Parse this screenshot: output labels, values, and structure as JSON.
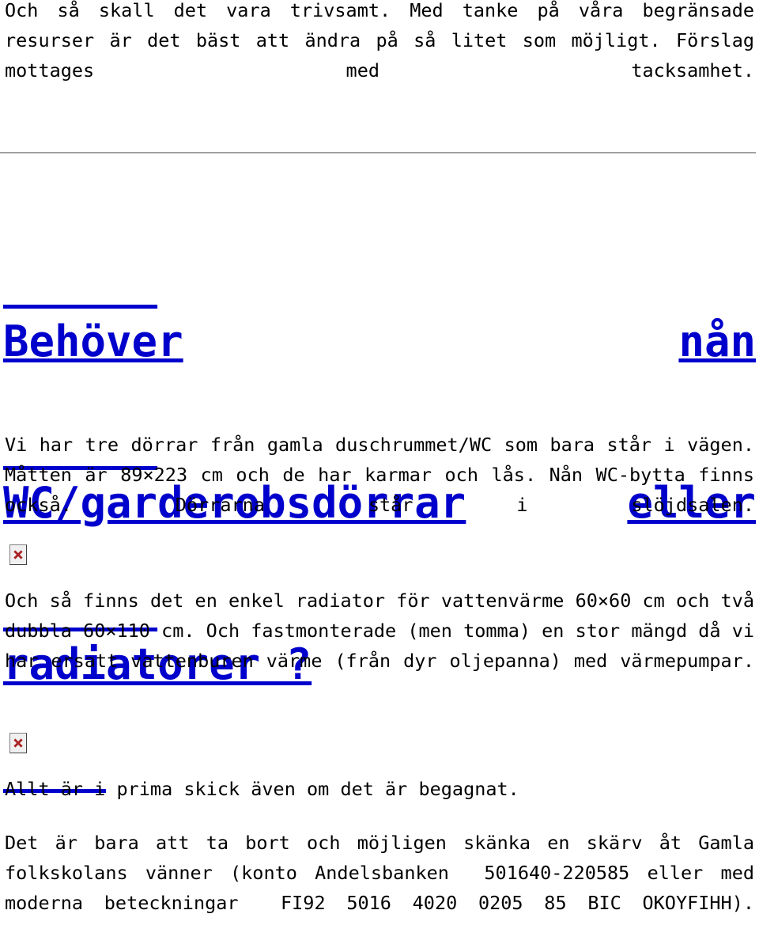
{
  "document": {
    "language": "sv",
    "background_color": "#ffffff",
    "body_text_color": "#000000",
    "link_color": "#0000cc",
    "rule_color": "#b0b0b0"
  },
  "intro": {
    "text": "Och så skall det vara trivsamt. Med tanke på våra begränsade resurser är det bäst att ändra på så litet som möjligt. Förslag mottages med tacksamhet."
  },
  "divider": {
    "name": "horizontal-rule"
  },
  "heading": {
    "full_text": "Behöver nån WC/garderobsdörrar eller radiatorer ?",
    "line1_left": "Behöver",
    "line1_right": "nån",
    "line2_left": "WC/garderobsdörrar",
    "line2_right": "eller",
    "line3": "radiatorer ?",
    "color": "#0000cc",
    "is_link": true
  },
  "doors": {
    "text": "Vi har tre dörrar från gamla duschrummet/WC som bara står i vägen. Måtten är 89×223 cm och de har karmar och lås. Nån WC-bytta finns också. Dörrarna står i slöjdsalen.",
    "dimensions": "89×223 cm"
  },
  "image_1": {
    "icon": "broken-image-icon",
    "alt": ""
  },
  "radiators": {
    "text": "Och så finns det en enkel radiator för vattenvärme 60×60 cm och två dubbla 60×110 cm. Och fastmonterade (men tomma) en stor mängd då vi har ersatt vattenburen värme (från dyr oljepanna) med värmepumpar.",
    "single_size": "60×60 cm",
    "double_size": "60×110 cm"
  },
  "image_2": {
    "icon": "broken-image-icon",
    "alt": ""
  },
  "condition": {
    "text": "Allt är i prima skick även om det är begagnat."
  },
  "donation": {
    "text": "Det är bara att ta bort och möjligen skänka en skärv åt Gamla folkskolans vänner (konto Andelsbanken  501640-220585 eller med moderna beteckningar  FI92 5016 4020 0205 85 BIC OKOYFIHH).",
    "organisation": "Gamla folkskolans vänner",
    "bank": "Andelsbanken",
    "account_number": "501640-220585",
    "iban": "FI92 5016 4020 0205 85",
    "bic": "OKOYFIHH"
  }
}
